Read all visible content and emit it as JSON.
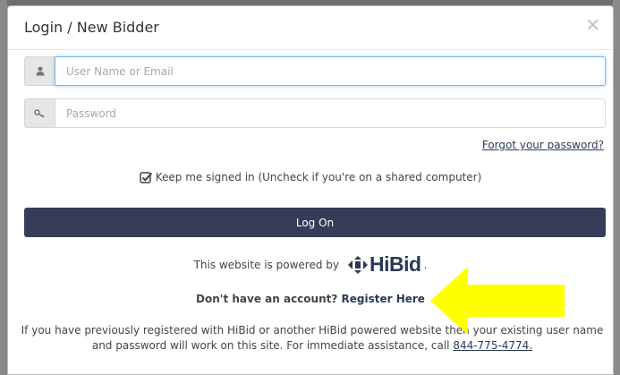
{
  "modal": {
    "title": "Login / New Bidder",
    "close_symbol": "×"
  },
  "form": {
    "username_placeholder": "User Name or Email",
    "password_placeholder": "Password",
    "forgot_link": "Forgot your password?",
    "remember_label": "Keep me signed in (Uncheck if you're on a shared computer)",
    "remember_checked": true,
    "logon_label": "Log On"
  },
  "powered": {
    "text": "This website is powered by",
    "brand": "HiBid",
    "suffix": "."
  },
  "register": {
    "prompt": "Don't have an account?",
    "link": "Register Here"
  },
  "info": {
    "text": "If you have previously registered with HiBid or another HiBid powered website then your existing user name and password will work on this site. For immediate assistance, call",
    "phone": "844-775-4774."
  },
  "icons": {
    "user": "user-icon",
    "key": "key-icon",
    "checkbox": "checkbox-checked-icon",
    "logo": "hibid-logo-icon",
    "arrow": "yellow-arrow-icon"
  },
  "colors": {
    "primary": "#353d58",
    "link": "#2d3a59",
    "focus": "#76b7e6",
    "arrow": "#ffff00"
  }
}
